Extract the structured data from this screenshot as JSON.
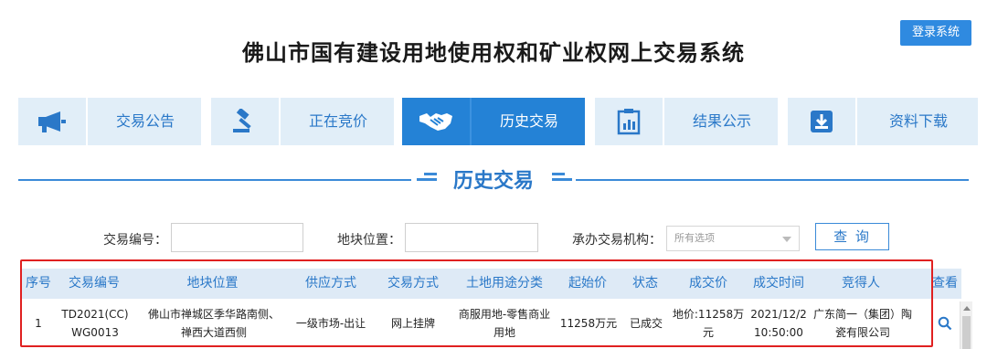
{
  "header": {
    "title": "佛山市国有建设用地使用权和矿业权网上交易系统",
    "login_label": "登录系统"
  },
  "nav": {
    "items": [
      {
        "label": "交易公告",
        "icon": "megaphone-icon"
      },
      {
        "label": "正在竞价",
        "icon": "gavel-icon"
      },
      {
        "label": "历史交易",
        "icon": "handshake-icon",
        "active": true
      },
      {
        "label": "结果公示",
        "icon": "chart-document-icon"
      },
      {
        "label": "资料下载",
        "icon": "download-icon"
      }
    ]
  },
  "section": {
    "title": "历史交易"
  },
  "search": {
    "trade_no_label": "交易编号：",
    "location_label": "地块位置：",
    "agency_label": "承办交易机构：",
    "agency_selected": "所有选项",
    "query_label": "查 询"
  },
  "table": {
    "headers": [
      "序号",
      "交易编号",
      "地块位置",
      "供应方式",
      "交易方式",
      "土地用途分类",
      "起始价",
      "状态",
      "成交价",
      "成交时间",
      "竞得人",
      "查看"
    ],
    "rows": [
      {
        "index": "1",
        "trade_no_1": "TD2021(CC)",
        "trade_no_2": "WG0013",
        "location_1": "佛山市禅城区季华路南侧、",
        "location_2": "禅西大道西侧",
        "supply": "一级市场-出让",
        "trade_mode": "网上挂牌",
        "land_use_1": "商服用地-零售商业",
        "land_use_2": "用地",
        "start_price": "11258万元",
        "status": "已成交",
        "deal_price_1": "地价:11258万",
        "deal_price_2": "元",
        "deal_time_1": "2021/12/2",
        "deal_time_2": "10:50:00",
        "winner_1": "广东简一（集团）陶",
        "winner_2": "瓷有限公司"
      }
    ]
  },
  "colors": {
    "brand_blue": "#2482d6",
    "nav_bg": "#e1eef8",
    "highlight_frame": "#e02020"
  }
}
